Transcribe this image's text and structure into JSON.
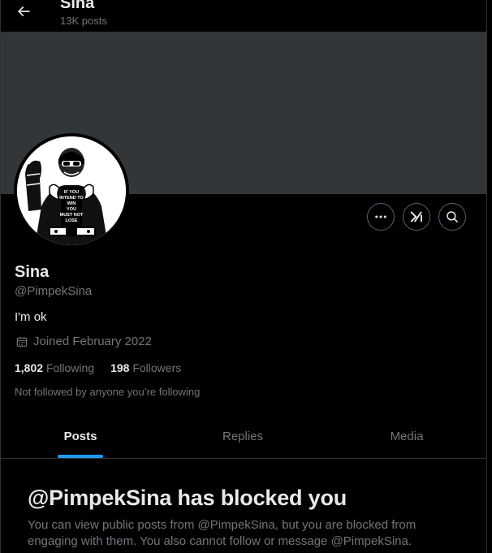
{
  "header": {
    "title": "Sina",
    "post_count": "13K posts",
    "back_icon": "arrow-left-icon"
  },
  "banner": {
    "color": "#333639"
  },
  "avatar": {
    "shirt_text": [
      "IF YOU",
      "INTEND TO",
      "WIN",
      "YOU",
      "MUST NOT",
      "LOSE"
    ]
  },
  "actions": {
    "more_icon": "more-horizontal-icon",
    "grok_icon": "grok-icon",
    "search_icon": "search-icon"
  },
  "profile": {
    "display_name": "Sina",
    "handle": "@PimpekSina",
    "bio": "I'm ok",
    "joined": "Joined February 2022",
    "following_count": "1,802",
    "following_label": "Following",
    "followers_count": "198",
    "followers_label": "Followers",
    "followed_note": "Not followed by anyone you’re following"
  },
  "tabs": [
    {
      "label": "Posts",
      "active": true
    },
    {
      "label": "Replies",
      "active": false
    },
    {
      "label": "Media",
      "active": false
    }
  ],
  "blocked": {
    "title": "@PimpekSina has blocked you",
    "text": "You can view public posts from @PimpekSina, but you are blocked from engaging with them. You also cannot follow or message @PimpekSina."
  },
  "colors": {
    "accent": "#1d9bf0",
    "background": "#000000",
    "text_primary": "#e7e9ea",
    "text_secondary": "#71767b",
    "border": "#2f3336"
  }
}
